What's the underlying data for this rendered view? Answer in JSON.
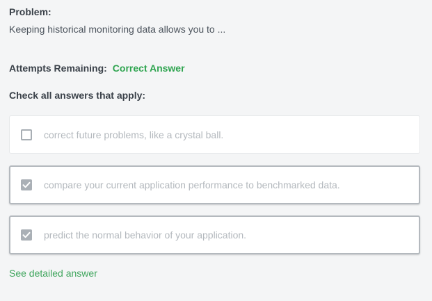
{
  "problem": {
    "heading": "Problem:",
    "text": "Keeping historical monitoring data allows you to ..."
  },
  "attempts": {
    "label": "Attempts Remaining:",
    "status": "Correct Answer",
    "status_color": "#2ea44f"
  },
  "instruction": "Check all answers that apply:",
  "options": [
    {
      "label": "correct future problems, like a crystal ball.",
      "checked": false
    },
    {
      "label": "compare your current application performance to benchmarked data.",
      "checked": true
    },
    {
      "label": "predict the normal behavior of your application.",
      "checked": true
    }
  ],
  "detail_link": {
    "label": "See detailed answer",
    "color": "#3ea55c"
  }
}
